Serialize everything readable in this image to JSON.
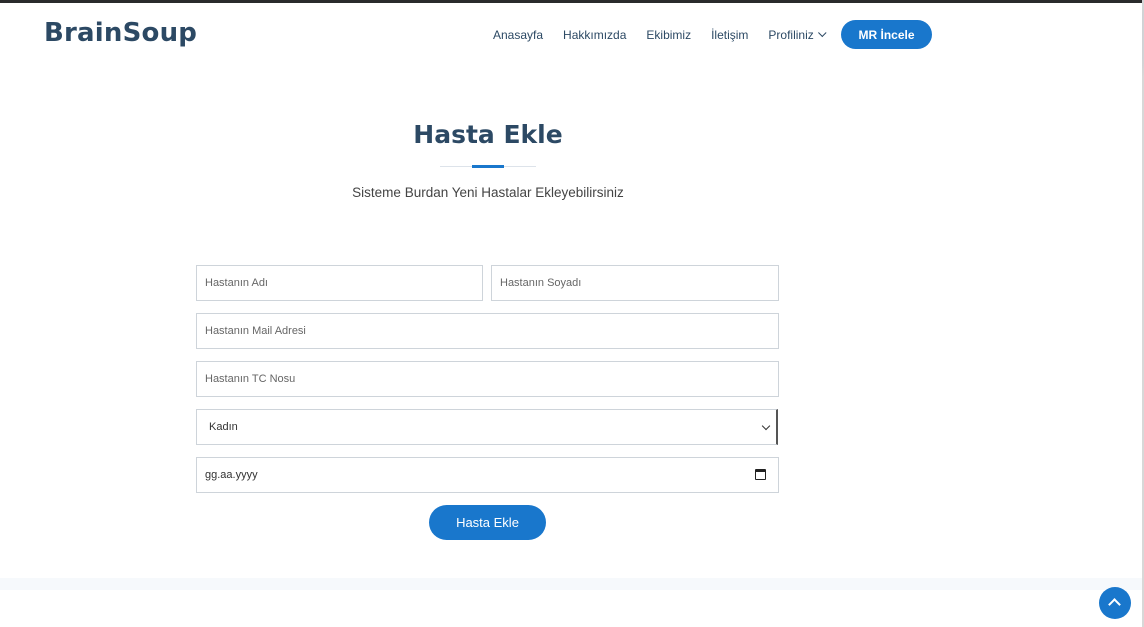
{
  "header": {
    "logo": "BrainSoup",
    "nav": [
      {
        "label": "Anasayfa"
      },
      {
        "label": "Hakkımızda"
      },
      {
        "label": "Ekibimiz"
      },
      {
        "label": "İletişim"
      },
      {
        "label": "Profiliniz"
      }
    ],
    "cta": "MR İncele"
  },
  "main": {
    "title": "Hasta Ekle",
    "subtitle": "Sisteme Burdan Yeni Hastalar Ekleyebilirsiniz"
  },
  "form": {
    "name_placeholder": "Hastanın Adı",
    "surname_placeholder": "Hastanın Soyadı",
    "mail_placeholder": "Hastanın Mail Adresi",
    "tc_placeholder": "Hastanın TC Nosu",
    "gender_value": "Kadın",
    "date_placeholder": "gg.aa.yyyy",
    "submit": "Hasta Ekle"
  },
  "colors": {
    "primary": "#1977cc",
    "heading": "#2c4964"
  },
  "icons": {
    "nav_dropdown": "chevron-down-icon",
    "select": "chevron-down-icon",
    "date": "calendar-icon",
    "back_to_top": "arrow-up-icon"
  }
}
